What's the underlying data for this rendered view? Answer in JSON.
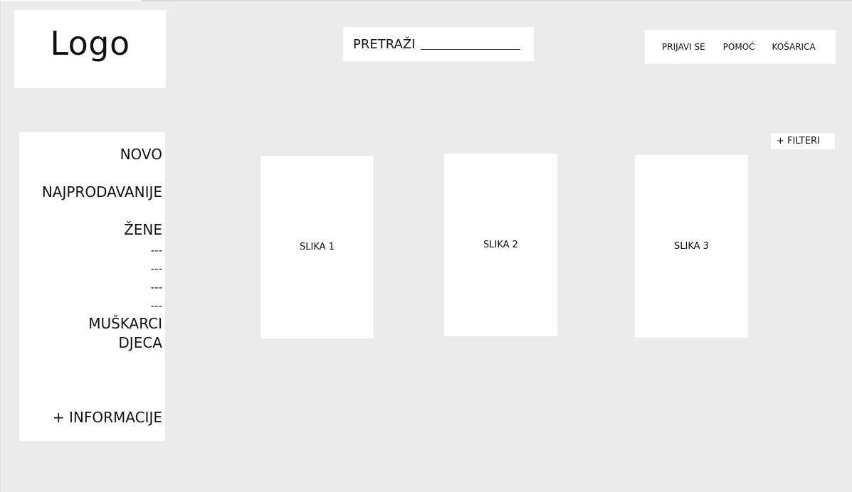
{
  "header": {
    "logo": "Logo",
    "search": {
      "label": "PRETRAŽI"
    },
    "nav": [
      "PRIJAVI SE",
      "POMOĆ",
      "KOŠARICA"
    ]
  },
  "sidebar": {
    "items": [
      "NOVO",
      "NAJPRODAVANIJE",
      "ŽENE",
      "---",
      "---",
      "---",
      "---",
      "MUŠKARCI",
      "DJECA"
    ],
    "info": "+ INFORMACIJE"
  },
  "main": {
    "filter_label": "+ FILTERI",
    "products": [
      "SLIKA 1",
      "SLIKA 2",
      "SLIKA 3"
    ]
  }
}
